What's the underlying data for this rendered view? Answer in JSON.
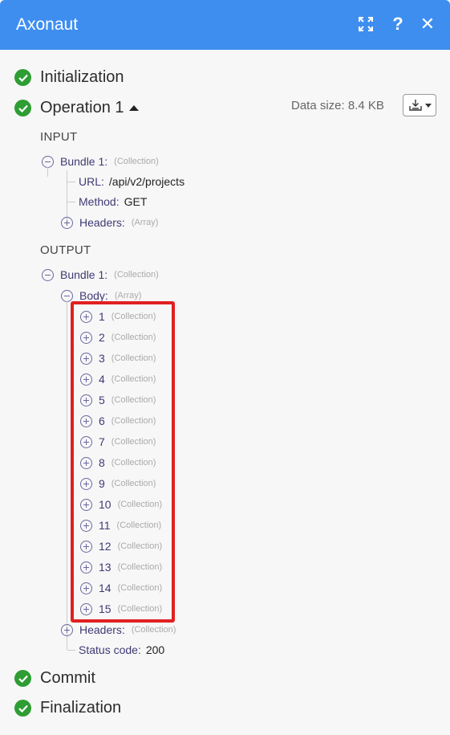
{
  "header": {
    "title": "Axonaut"
  },
  "stages": {
    "initialization": "Initialization",
    "operation": "Operation 1",
    "commit": "Commit",
    "finalization": "Finalization"
  },
  "data_size": "Data size: 8.4 KB",
  "input": {
    "section": "INPUT",
    "bundle_key": "Bundle 1:",
    "bundle_type": "(Collection)",
    "url_key": "URL:",
    "url_value": "/api/v2/projects",
    "method_key": "Method:",
    "method_value": "GET",
    "headers_key": "Headers:",
    "headers_type": "(Array)"
  },
  "output": {
    "section": "OUTPUT",
    "bundle_key": "Bundle 1:",
    "bundle_type": "(Collection)",
    "body_key": "Body:",
    "body_type": "(Array)",
    "items": [
      {
        "key": "1",
        "type": "(Collection)"
      },
      {
        "key": "2",
        "type": "(Collection)"
      },
      {
        "key": "3",
        "type": "(Collection)"
      },
      {
        "key": "4",
        "type": "(Collection)"
      },
      {
        "key": "5",
        "type": "(Collection)"
      },
      {
        "key": "6",
        "type": "(Collection)"
      },
      {
        "key": "7",
        "type": "(Collection)"
      },
      {
        "key": "8",
        "type": "(Collection)"
      },
      {
        "key": "9",
        "type": "(Collection)"
      },
      {
        "key": "10",
        "type": "(Collection)"
      },
      {
        "key": "11",
        "type": "(Collection)"
      },
      {
        "key": "12",
        "type": "(Collection)"
      },
      {
        "key": "13",
        "type": "(Collection)"
      },
      {
        "key": "14",
        "type": "(Collection)"
      },
      {
        "key": "15",
        "type": "(Collection)"
      }
    ],
    "headers_key": "Headers:",
    "headers_type": "(Collection)",
    "status_key": "Status code:",
    "status_value": "200"
  },
  "colors": {
    "header": "#3e8ef0",
    "success": "#2e9d33",
    "highlight": "#e02020"
  }
}
